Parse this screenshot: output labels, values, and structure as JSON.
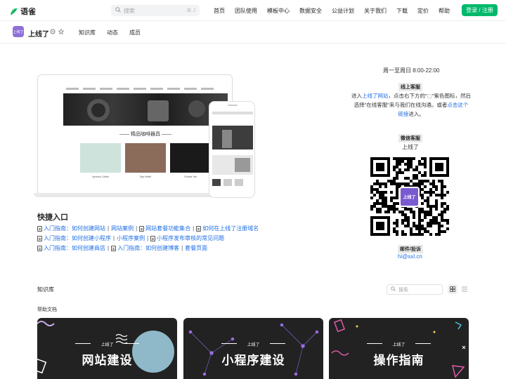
{
  "app": {
    "logo_text": "语雀"
  },
  "search": {
    "placeholder": "搜索",
    "shortcut": "⌘ J"
  },
  "nav": {
    "items": [
      "首页",
      "团队使用",
      "模板中心",
      "数据安全",
      "公益计划",
      "关于我们",
      "下载",
      "定价",
      "帮助"
    ]
  },
  "login_label": "登录 / 注册",
  "space": {
    "avatar_text": "上线了",
    "name": "上线了",
    "tabs": [
      "知识库",
      "动态",
      "成员"
    ]
  },
  "hero": {
    "screen_title": "—— 精品咖啡器具 ——",
    "products": [
      "Xpresso Coffee",
      "Drip Kettle",
      "Grinder Set"
    ]
  },
  "quick": {
    "title": "快捷入口",
    "rows": [
      [
        "入门指南：如何创建网站",
        "网站案例",
        "网站套餐功能集合",
        "如何在上线了注册域名"
      ],
      [
        "入门指南：如何创建小程序",
        "小程序案例",
        "小程序发布审核的常见问题"
      ],
      [
        "入门指南：如何创建商店",
        "入门指南：如何创建博客",
        "套餐页面"
      ]
    ]
  },
  "contact": {
    "hours": "周一至周日 8:00-22:00",
    "online_tag": "线上客服",
    "online_text_1": "进入",
    "online_link_1": "上线了网站",
    "online_text_2": "，点击右下方的\"",
    "online_text_3": "\"紫色图标，然后选择\"在线客服\"来与我们在线沟通。或者",
    "online_link_2": "点击这个链接",
    "online_text_4": "进入。",
    "wechat_tag": "微信客服",
    "wechat_name": "上线了",
    "qr_logo": "上线了",
    "email_tag": "邮件/投诉",
    "email": "hi@sxl.cn"
  },
  "kb": {
    "title": "知识库",
    "search_placeholder": "搜索",
    "group_title": "帮助文档",
    "books": [
      {
        "brand": "上线了",
        "title": "网站建设"
      },
      {
        "brand": "上线了",
        "title": "小程序建设"
      },
      {
        "brand": "上线了",
        "title": "操作指南"
      }
    ]
  },
  "colors": {
    "accent": "#00b96b",
    "link": "#1f6fe5",
    "brand_purple": "#7a5ad0"
  }
}
